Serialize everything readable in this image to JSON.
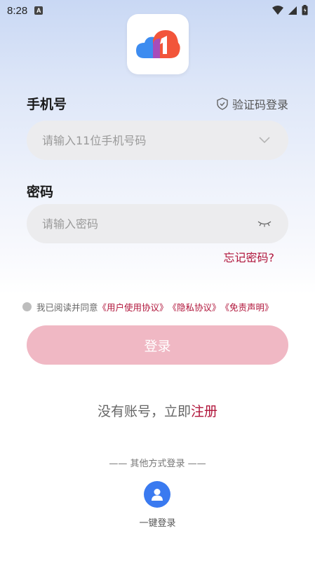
{
  "status_bar": {
    "time": "8:28",
    "notification_letter": "A"
  },
  "phone": {
    "label": "手机号",
    "placeholder": "请输入11位手机号码",
    "value": ""
  },
  "sms_login": {
    "label": "验证码登录"
  },
  "password": {
    "label": "密码",
    "placeholder": "请输入密码",
    "value": ""
  },
  "forgot_password": "忘记密码?",
  "agreement": {
    "prefix": "我已阅读并同意",
    "user_agreement": "《用户使用协议》",
    "privacy": "《隐私协议》",
    "disclaimer": "《免责声明》",
    "checked": false
  },
  "login_button": "登录",
  "register": {
    "prefix": "没有账号，立即",
    "link": "注册"
  },
  "other_methods": "—— 其他方式登录 ——",
  "one_key_login": "一键登录",
  "colors": {
    "accent": "#b0143a",
    "login_button": "#f0b8c4",
    "one_key": "#3a7af0",
    "input_bg": "#ececee"
  },
  "icons": {
    "logo": "cloud-one-logo",
    "sms": "shield-check-icon",
    "phone_dropdown": "chevron-down-icon",
    "password_toggle": "eye-closed-icon",
    "one_key": "user-icon"
  }
}
